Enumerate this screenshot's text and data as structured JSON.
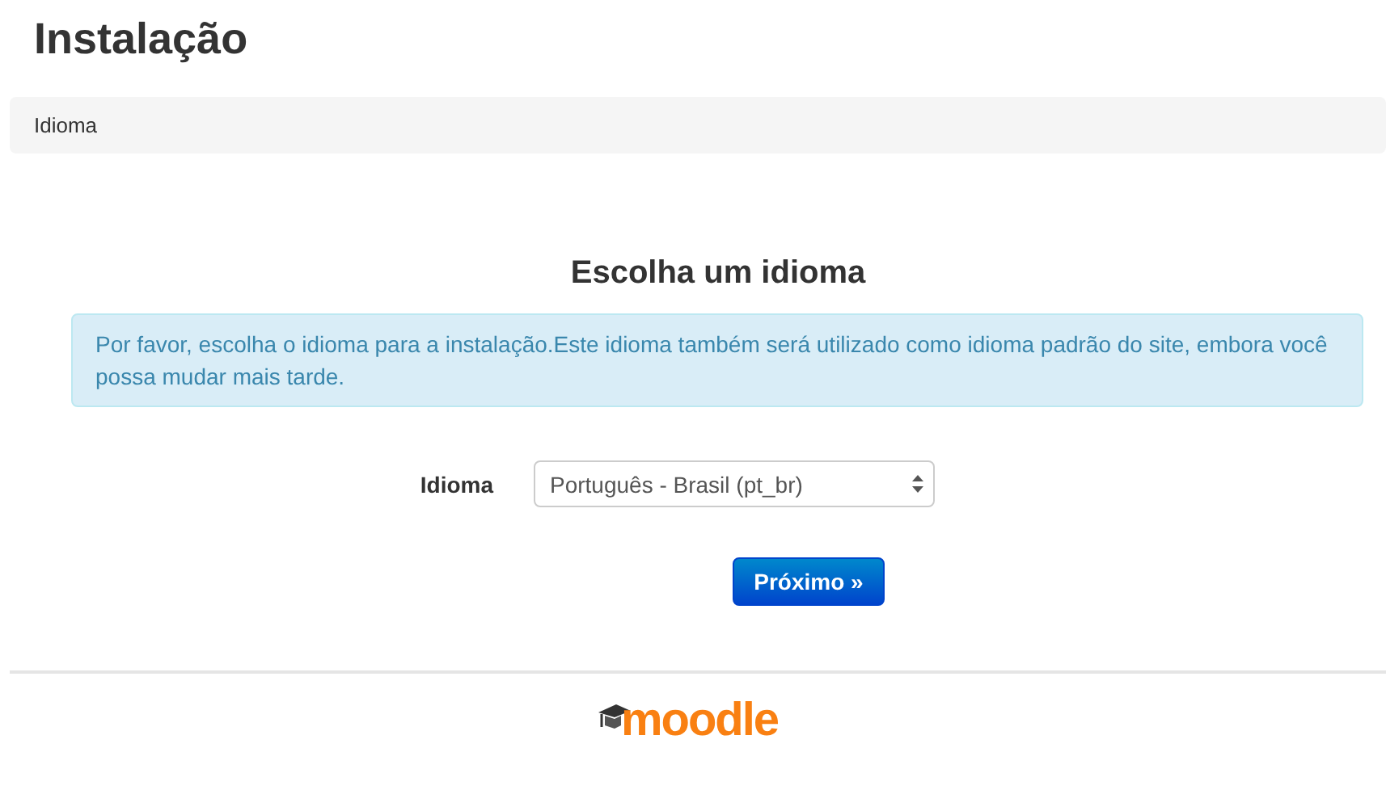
{
  "page_title": "Instalação",
  "breadcrumb": "Idioma",
  "heading": "Escolha um idioma",
  "alert": "Por favor, escolha o idioma para a instalação.Este idioma também será utilizado como idioma padrão do site, embora você possa mudar mais tarde.",
  "form": {
    "label": "Idioma",
    "value": "Português - Brasil (pt_br)"
  },
  "button": "Próximo »",
  "footer_logo": "moodle"
}
